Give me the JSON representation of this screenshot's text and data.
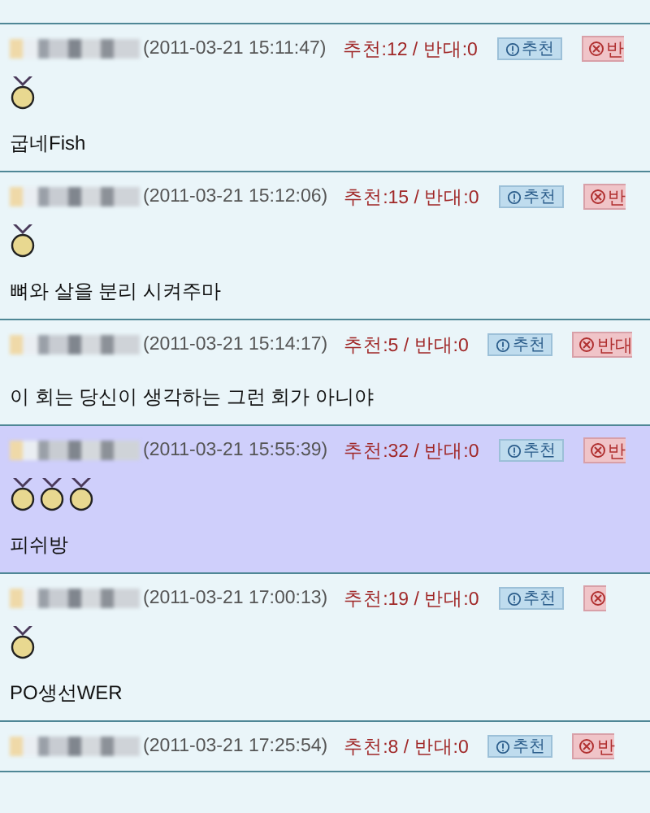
{
  "comments": [
    {
      "date": "(2011-03-21 15:11:47)",
      "votes": "추천:12 / 반대:0",
      "recommend_button": "추천",
      "oppose_button": "반",
      "medals": [
        {
          "kind": "gold"
        }
      ],
      "text": "굽네Fish",
      "highlighted": false
    },
    {
      "date": "(2011-03-21 15:12:06)",
      "votes": "추천:15 / 반대:0",
      "recommend_button": "추천",
      "oppose_button": "반",
      "medals": [
        {
          "kind": "gold"
        }
      ],
      "text": "뼈와 살을 분리 시켜주마",
      "highlighted": false
    },
    {
      "date": "(2011-03-21 15:14:17)",
      "votes": "추천:5 / 반대:0",
      "recommend_button": "추천",
      "oppose_button": "반대",
      "text": "이 회는 당신이 생각하는 그런 회가 아니야",
      "highlighted": false
    },
    {
      "date": "(2011-03-21 15:55:39)",
      "votes": "추천:32 / 반대:0",
      "recommend_button": "추천",
      "oppose_button": "반",
      "medals": [
        {
          "kind": "gold"
        },
        {
          "kind": "gold"
        },
        {
          "kind": "gold"
        }
      ],
      "text": "피쉬방",
      "highlighted": true
    },
    {
      "date": "(2011-03-21 17:00:13)",
      "votes": "추천:19 / 반대:0",
      "recommend_button": "추천",
      "medals": [
        {
          "kind": "gold"
        }
      ],
      "text": "PO생선WER",
      "highlighted": false
    },
    {
      "date": "(2011-03-21 17:25:54)",
      "votes": "추천:8 / 반대:0",
      "recommend_button": "추천",
      "oppose_button": "반",
      "highlighted": false
    }
  ]
}
